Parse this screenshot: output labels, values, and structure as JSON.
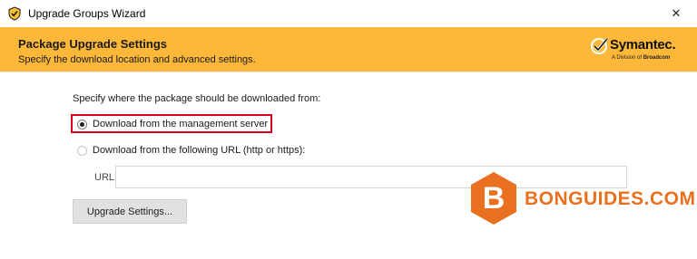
{
  "window": {
    "title": "Upgrade Groups Wizard",
    "app_icon": "shield-icon",
    "close_glyph": "✕"
  },
  "header": {
    "title": "Package Upgrade Settings",
    "subtitle": "Specify the download location and advanced settings.",
    "logo": {
      "name": "Symantec.",
      "tagline_prefix": "A Division of ",
      "tagline_brand": "Broadcom"
    },
    "background_color": "#fdb83a"
  },
  "main": {
    "prompt": "Specify where the package should be downloaded from:",
    "options": [
      {
        "label": "Download from the management server",
        "selected": true
      },
      {
        "label": "Download from the following URL (http or https):",
        "selected": false
      }
    ],
    "url": {
      "label": "URL:",
      "value": "",
      "placeholder": ""
    },
    "upgrade_settings_button": "Upgrade Settings...",
    "highlight_color": "#d6001c"
  },
  "watermark": {
    "letter": "B",
    "text": "BONGUIDES.COM",
    "color": "#e8701f"
  }
}
